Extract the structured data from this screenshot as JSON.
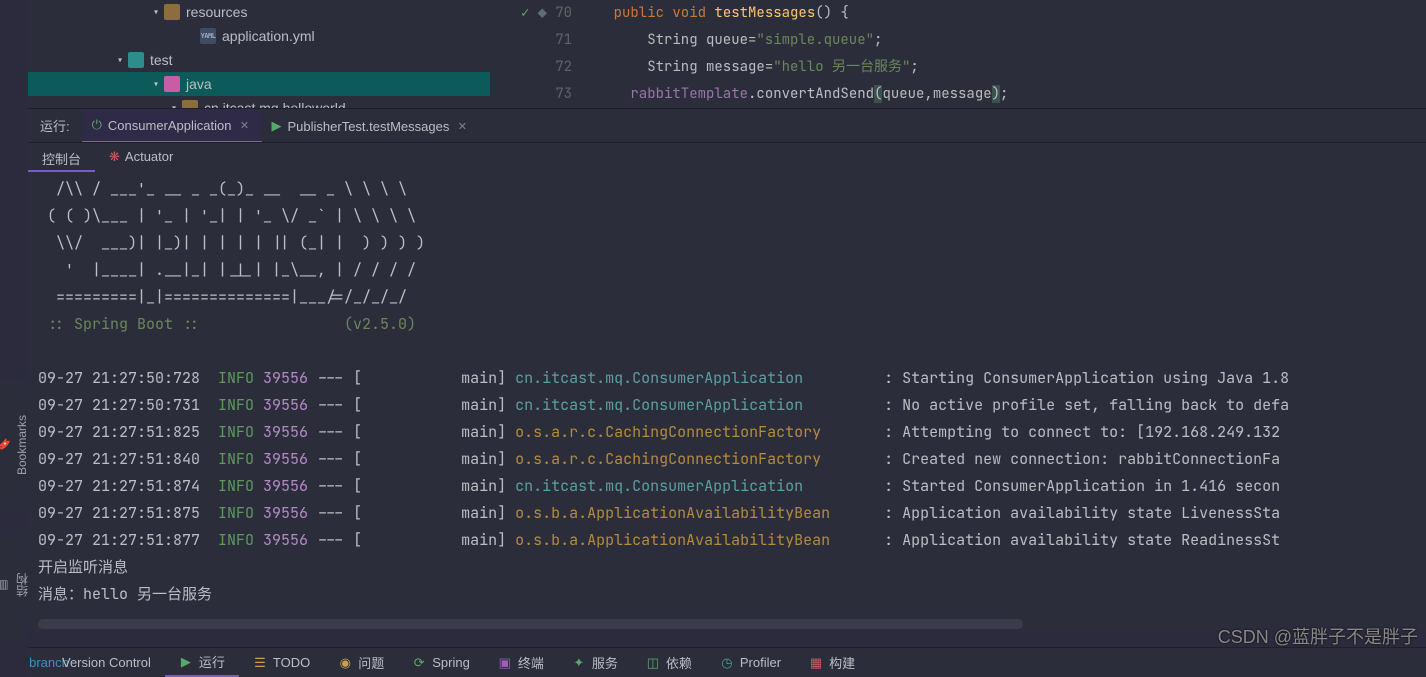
{
  "tree": {
    "rows": [
      {
        "indent": 120,
        "chev": "▾",
        "kind": "folder-brown",
        "label": "resources",
        "sel": false,
        "icon_name": "folder-icon"
      },
      {
        "indent": 156,
        "chev": "",
        "kind": "file-yaml",
        "label": "application.yml",
        "sel": false,
        "icon_name": "yaml-file-icon",
        "file_badge": "YAML"
      },
      {
        "indent": 84,
        "chev": "▾",
        "kind": "folder-teal",
        "label": "test",
        "sel": false,
        "icon_name": "folder-icon"
      },
      {
        "indent": 120,
        "chev": "▾",
        "kind": "folder-pink",
        "label": "java",
        "sel": true,
        "icon_name": "folder-icon"
      },
      {
        "indent": 138,
        "chev": "▾",
        "kind": "folder-brown",
        "label": "cn.itcast.mq.helloworld",
        "sel": false,
        "icon_name": "package-icon"
      }
    ]
  },
  "editor": {
    "lines": [
      {
        "num": "70",
        "gutter": "check",
        "html": "    <span class='kw'>public void</span> <span class='method'>testMessages</span><span class='punct'>() {</span>"
      },
      {
        "num": "71",
        "gutter": "",
        "html": "        String <span class='ident'>queue</span>=<span class='str'>\"simple.queue\"</span>;"
      },
      {
        "num": "72",
        "gutter": "",
        "html": "        String <span class='ident'>message</span>=<span class='str'>\"hello 另一台服务\"</span>;"
      },
      {
        "num": "73",
        "gutter": "bkpt",
        "html": "      <span class='field'>rabbitTemplate</span>.<span class='ident'>convertAndSend</span><span class='punct bracket-hl'>(</span>queue,message<span class='punct bracket-hl'>)</span>;"
      }
    ]
  },
  "run": {
    "label": "运行:",
    "tabs": [
      {
        "icon": "power",
        "label": "ConsumerApplication",
        "active": true,
        "icon_name": "run-power-icon"
      },
      {
        "icon": "arrow",
        "label": "PublisherTest.testMessages",
        "active": false,
        "icon_name": "run-arrow-icon"
      }
    ]
  },
  "sub_tabs": [
    {
      "label": "控制台",
      "icon": "",
      "active": true
    },
    {
      "label": "Actuator",
      "icon": "act",
      "active": false
    }
  ],
  "console": {
    "banner": [
      "  /\\\\ / ___'_ __ _ _(_)_ __  __ _ \\ \\ \\ \\",
      " ( ( )\\___ | '_ | '_| | '_ \\/ _` | \\ \\ \\ \\",
      "  \\\\/  ___)| |_)| | | | | || (_| |  ) ) ) )",
      "   '  |____| .__|_| |_|_| |_\\__, | / / / /",
      "  =========|_|==============|___/=/_/_/_/"
    ],
    "boot_line": " :: Spring Boot ::                (v2.5.0)",
    "logs": [
      {
        "ts": "09-27 21:27:50:728",
        "lvl": "INFO",
        "pid": "39556",
        "thread": "main",
        "logger": "cn.itcast.mq.ConsumerApplication",
        "lc": "y",
        "msg": "Starting ConsumerApplication using Java 1.8"
      },
      {
        "ts": "09-27 21:27:50:731",
        "lvl": "INFO",
        "pid": "39556",
        "thread": "main",
        "logger": "cn.itcast.mq.ConsumerApplication",
        "lc": "y",
        "msg": "No active profile set, falling back to defa"
      },
      {
        "ts": "09-27 21:27:51:825",
        "lvl": "INFO",
        "pid": "39556",
        "thread": "main",
        "logger": "o.s.a.r.c.CachingConnectionFactory",
        "lc": "o",
        "msg": "Attempting to connect to: [192.168.249.132"
      },
      {
        "ts": "09-27 21:27:51:840",
        "lvl": "INFO",
        "pid": "39556",
        "thread": "main",
        "logger": "o.s.a.r.c.CachingConnectionFactory",
        "lc": "o",
        "msg": "Created new connection: rabbitConnectionFa"
      },
      {
        "ts": "09-27 21:27:51:874",
        "lvl": "INFO",
        "pid": "39556",
        "thread": "main",
        "logger": "cn.itcast.mq.ConsumerApplication",
        "lc": "y",
        "msg": "Started ConsumerApplication in 1.416 secon"
      },
      {
        "ts": "09-27 21:27:51:875",
        "lvl": "INFO",
        "pid": "39556",
        "thread": "main",
        "logger": "o.s.b.a.ApplicationAvailabilityBean",
        "lc": "o",
        "msg": "Application availability state LivenessSta"
      },
      {
        "ts": "09-27 21:27:51:877",
        "lvl": "INFO",
        "pid": "39556",
        "thread": "main",
        "logger": "o.s.b.a.ApplicationAvailabilityBean",
        "lc": "o",
        "msg": "Application availability state ReadinessSt"
      }
    ],
    "tail": [
      "开启监听消息",
      "消息：hello 另一台服务",
      ""
    ]
  },
  "side_tools": {
    "bookmarks": "Bookmarks",
    "structure": "结构"
  },
  "statusbar": [
    {
      "label": "Version Control",
      "icon": "branch",
      "color": "c-blue",
      "active": false,
      "icon_name": "branch-icon"
    },
    {
      "label": "运行",
      "icon": "▶",
      "color": "c-green",
      "active": true,
      "icon_name": "run-icon"
    },
    {
      "label": "TODO",
      "icon": "☰",
      "color": "c-yellow",
      "active": false,
      "icon_name": "todo-icon"
    },
    {
      "label": "问题",
      "icon": "◉",
      "color": "c-yellow",
      "active": false,
      "icon_name": "problems-icon"
    },
    {
      "label": "Spring",
      "icon": "⟳",
      "color": "c-green",
      "active": false,
      "icon_name": "spring-icon"
    },
    {
      "label": "终端",
      "icon": "▣",
      "color": "c-mag",
      "active": false,
      "icon_name": "terminal-icon"
    },
    {
      "label": "服务",
      "icon": "✦",
      "color": "c-green",
      "active": false,
      "icon_name": "services-icon"
    },
    {
      "label": "依赖",
      "icon": "◫",
      "color": "c-green",
      "active": false,
      "icon_name": "dependencies-icon"
    },
    {
      "label": "Profiler",
      "icon": "◷",
      "color": "c-teal",
      "active": false,
      "icon_name": "profiler-icon"
    },
    {
      "label": "构建",
      "icon": "▦",
      "color": "c-red",
      "active": false,
      "icon_name": "build-icon"
    }
  ],
  "watermark": "CSDN @蓝胖子不是胖子"
}
